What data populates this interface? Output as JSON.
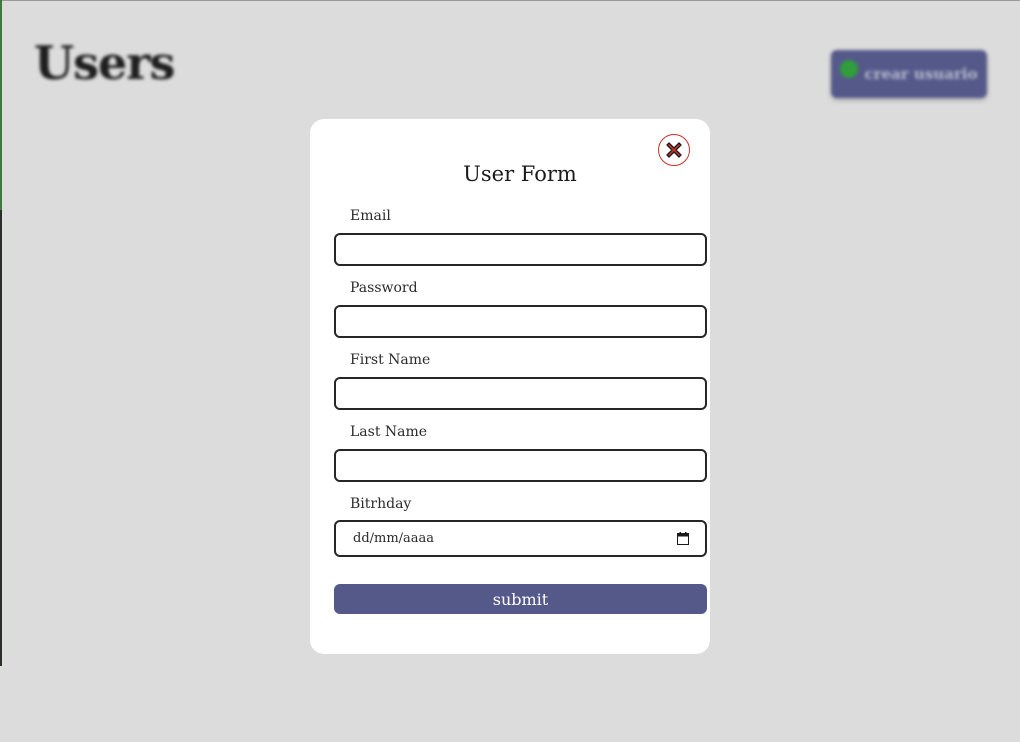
{
  "page": {
    "title": "Users",
    "create_button_label": "crear usuario"
  },
  "form": {
    "title": "User Form",
    "fields": [
      {
        "label": "Email",
        "value": ""
      },
      {
        "label": "Password",
        "value": ""
      },
      {
        "label": "First Name",
        "value": ""
      },
      {
        "label": "Last Name",
        "value": ""
      },
      {
        "label": "Bitrhday",
        "value": "dd/mm/aaaa"
      }
    ],
    "submit_label": "submit"
  },
  "colors": {
    "background": "#dcdcdc",
    "modal": "#ffffff",
    "accent": "#55598a",
    "close": "#c8322a",
    "plus": "#2f9e3b"
  },
  "icons": [
    "plus-icon",
    "close-icon",
    "calendar-icon"
  ]
}
